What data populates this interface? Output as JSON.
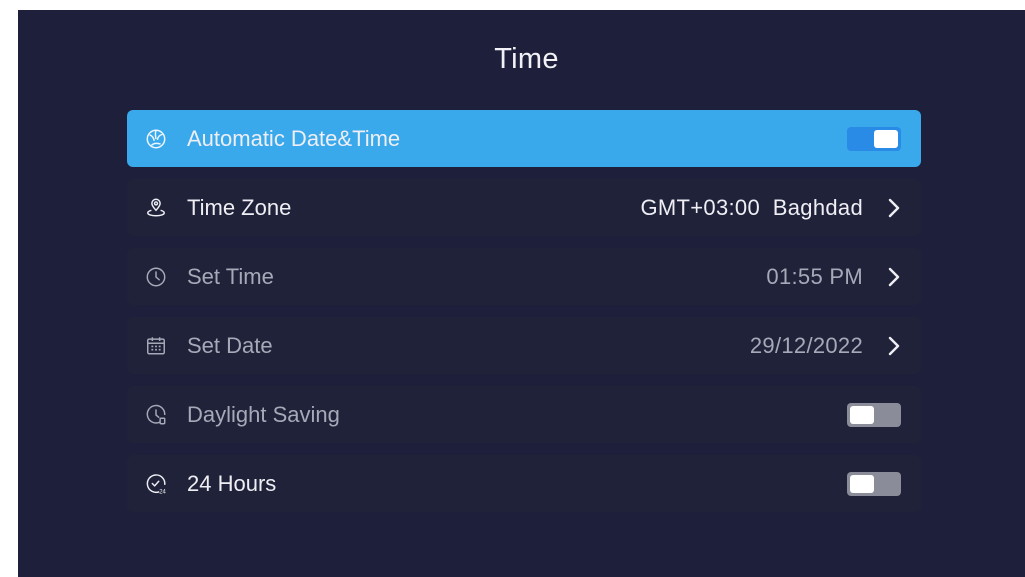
{
  "screen": {
    "title": "Time"
  },
  "settings": {
    "items": [
      {
        "label": "Automatic Date&Time",
        "icon": "globe-icon",
        "toggle": true
      },
      {
        "label": "Time Zone",
        "icon": "location-pin-icon",
        "value": "GMT+03:00  Baghdad"
      },
      {
        "label": "Set Time",
        "icon": "clock-icon",
        "value": "01:55 PM"
      },
      {
        "label": "Set Date",
        "icon": "calendar-icon",
        "value": "29/12/2022"
      },
      {
        "label": "Daylight Saving",
        "icon": "daylight-clock-icon",
        "toggle": false
      },
      {
        "label": "24 Hours",
        "icon": "clock-24-icon",
        "toggle": false
      }
    ]
  },
  "colors": {
    "background": "#1d1f3b",
    "row": "#202239",
    "focus": "#3aa9ec",
    "toggle_on": "#2a8be6",
    "toggle_off": "#8a8c99"
  }
}
